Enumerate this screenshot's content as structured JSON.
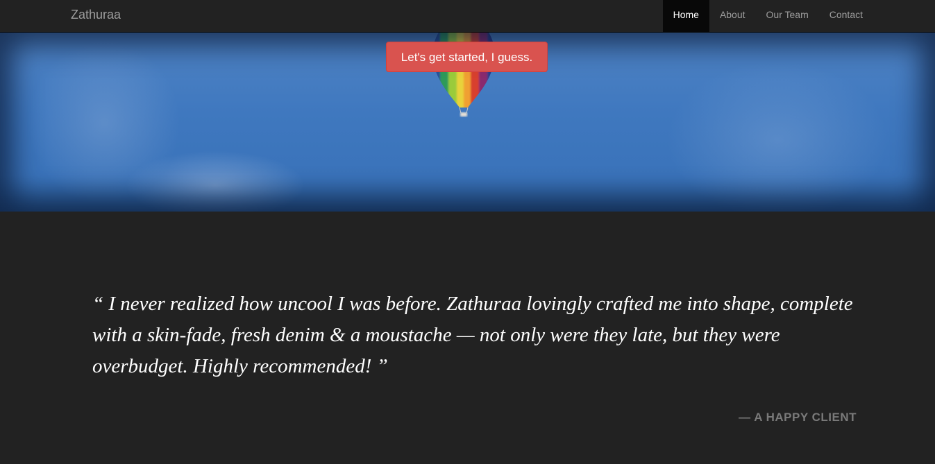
{
  "navbar": {
    "brand": "Zathuraa",
    "items": [
      {
        "label": "Home",
        "active": true
      },
      {
        "label": "About",
        "active": false
      },
      {
        "label": "Our Team",
        "active": false
      },
      {
        "label": "Contact",
        "active": false
      }
    ]
  },
  "hero": {
    "cta_label": "Let's get started, I guess.",
    "background_icon": "hot-air-balloon-icon"
  },
  "testimonial": {
    "quote": "“ I never realized how uncool I was before. Zathuraa lovingly crafted me into shape, complete with a skin-fade, fresh denim & a moustache — not only were they late, but they were overbudget. Highly recommended! ”",
    "attribution": "— A HAPPY CLIENT"
  },
  "colors": {
    "navbar_bg": "#222222",
    "active_nav_bg": "#080808",
    "cta_bg": "#d9534f",
    "page_bg": "#222222",
    "sky": "#3f78bf"
  }
}
